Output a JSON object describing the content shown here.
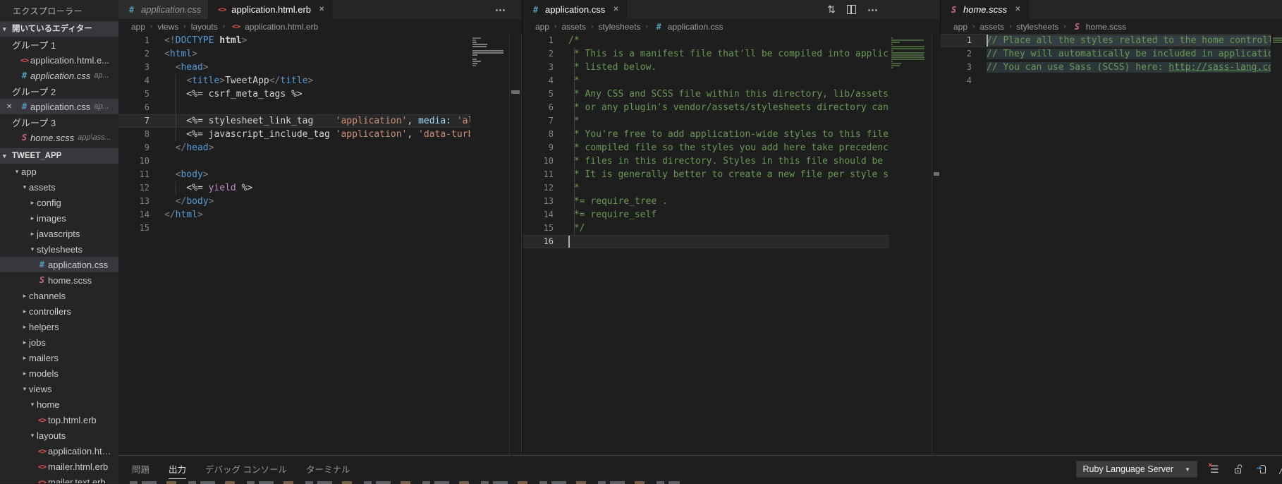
{
  "sidebar": {
    "title": "エクスプローラー",
    "open_editors_header": "開いているエディター",
    "open_editor_groups": [
      {
        "label": "グループ 1",
        "items": [
          {
            "icon": "erb-file-icon",
            "name": "application.html.e...",
            "desc": "",
            "italic": false,
            "selected": false,
            "close": false
          },
          {
            "icon": "css-file-icon",
            "name": "application.css",
            "desc": "ap...",
            "italic": true,
            "selected": false,
            "close": false
          }
        ]
      },
      {
        "label": "グループ 2",
        "items": [
          {
            "icon": "css-file-icon",
            "name": "application.css",
            "desc": "ap...",
            "italic": false,
            "selected": true,
            "close": true
          }
        ]
      },
      {
        "label": "グループ 3",
        "items": [
          {
            "icon": "scss-file-icon",
            "name": "home.scss",
            "desc": "app\\ass...",
            "italic": true,
            "selected": false,
            "close": false
          }
        ]
      }
    ],
    "project_name": "TWEET_APP",
    "tree": [
      {
        "depth": 0,
        "arrow": "expanded",
        "label": "app"
      },
      {
        "depth": 1,
        "arrow": "expanded",
        "label": "assets"
      },
      {
        "depth": 2,
        "arrow": "collapsed",
        "label": "config"
      },
      {
        "depth": 2,
        "arrow": "collapsed",
        "label": "images"
      },
      {
        "depth": 2,
        "arrow": "collapsed",
        "label": "javascripts"
      },
      {
        "depth": 2,
        "arrow": "expanded",
        "label": "stylesheets"
      },
      {
        "depth": 3,
        "icon": "css-file-icon",
        "label": "application.css",
        "selected": true
      },
      {
        "depth": 3,
        "icon": "scss-file-icon",
        "label": "home.scss"
      },
      {
        "depth": 1,
        "arrow": "collapsed",
        "label": "channels"
      },
      {
        "depth": 1,
        "arrow": "collapsed",
        "label": "controllers"
      },
      {
        "depth": 1,
        "arrow": "collapsed",
        "label": "helpers"
      },
      {
        "depth": 1,
        "arrow": "collapsed",
        "label": "jobs"
      },
      {
        "depth": 1,
        "arrow": "collapsed",
        "label": "mailers"
      },
      {
        "depth": 1,
        "arrow": "collapsed",
        "label": "models"
      },
      {
        "depth": 1,
        "arrow": "expanded",
        "label": "views"
      },
      {
        "depth": 2,
        "arrow": "expanded",
        "label": "home"
      },
      {
        "depth": 3,
        "icon": "erb-file-icon",
        "label": "top.html.erb"
      },
      {
        "depth": 2,
        "arrow": "expanded",
        "label": "layouts"
      },
      {
        "depth": 3,
        "icon": "erb-file-icon",
        "label": "application.html.e..."
      },
      {
        "depth": 3,
        "icon": "erb-file-icon",
        "label": "mailer.html.erb"
      },
      {
        "depth": 3,
        "icon": "erb-file-icon",
        "label": "mailer.text.erb"
      }
    ]
  },
  "editor_groups": [
    {
      "tabs": [
        {
          "icon": "erb-file-icon",
          "label": "application.html.erb",
          "active": true,
          "italic": false,
          "close": true
        },
        {
          "icon": "css-file-icon",
          "label": "application.css",
          "active": false,
          "italic": true,
          "close": false
        }
      ],
      "actions": [
        "more-actions"
      ],
      "breadcrumb": [
        {
          "label": "app"
        },
        {
          "label": "views"
        },
        {
          "label": "layouts"
        },
        {
          "label": "application.html.erb",
          "icon": "erb-file-icon"
        }
      ],
      "current_line": 7,
      "lines": [
        {
          "n": 1,
          "seg": [
            [
              "pun",
              "<!"
            ],
            [
              "tag",
              "DOCTYPE"
            ],
            [
              "txt",
              " "
            ],
            [
              "bold",
              "html"
            ],
            [
              "pun",
              ">"
            ]
          ]
        },
        {
          "n": 2,
          "seg": [
            [
              "pun",
              "<"
            ],
            [
              "tag",
              "html"
            ],
            [
              "pun",
              ">"
            ]
          ]
        },
        {
          "n": 3,
          "seg": [
            [
              "txt",
              "  "
            ],
            [
              "pun",
              "<"
            ],
            [
              "tag",
              "head"
            ],
            [
              "pun",
              ">"
            ]
          ]
        },
        {
          "n": 4,
          "seg": [
            [
              "txt",
              "    "
            ],
            [
              "pun",
              "<"
            ],
            [
              "tag",
              "title"
            ],
            [
              "pun",
              ">"
            ],
            [
              "txt",
              "TweetApp"
            ],
            [
              "pun",
              "</"
            ],
            [
              "tag",
              "title"
            ],
            [
              "pun",
              ">"
            ]
          ],
          "g": [
            2
          ]
        },
        {
          "n": 5,
          "seg": [
            [
              "txt",
              "    <%= csrf_meta_tags %>"
            ]
          ],
          "g": [
            2
          ]
        },
        {
          "n": 6,
          "seg": [],
          "g": [
            2
          ]
        },
        {
          "n": 7,
          "seg": [
            [
              "txt",
              "    <%= stylesheet_link_tag    "
            ],
            [
              "str",
              "'application'"
            ],
            [
              "txt",
              ", "
            ],
            [
              "attr",
              "media:"
            ],
            [
              "txt",
              " "
            ],
            [
              "str",
              "'al"
            ]
          ],
          "g": [
            2
          ]
        },
        {
          "n": 8,
          "seg": [
            [
              "txt",
              "    <%= javascript_include_tag "
            ],
            [
              "str",
              "'application'"
            ],
            [
              "txt",
              ", "
            ],
            [
              "str",
              "'data-turb"
            ]
          ],
          "g": [
            2
          ]
        },
        {
          "n": 9,
          "seg": [
            [
              "txt",
              "  "
            ],
            [
              "pun",
              "</"
            ],
            [
              "tag",
              "head"
            ],
            [
              "pun",
              ">"
            ]
          ]
        },
        {
          "n": 10,
          "seg": []
        },
        {
          "n": 11,
          "seg": [
            [
              "txt",
              "  "
            ],
            [
              "pun",
              "<"
            ],
            [
              "tag",
              "body"
            ],
            [
              "pun",
              ">"
            ]
          ]
        },
        {
          "n": 12,
          "seg": [
            [
              "txt",
              "    <%= "
            ],
            [
              "kw",
              "yield"
            ],
            [
              "txt",
              " %>"
            ]
          ],
          "g": [
            2
          ]
        },
        {
          "n": 13,
          "seg": [
            [
              "txt",
              "  "
            ],
            [
              "pun",
              "</"
            ],
            [
              "tag",
              "body"
            ],
            [
              "pun",
              ">"
            ]
          ]
        },
        {
          "n": 14,
          "seg": [
            [
              "pun",
              "</"
            ],
            [
              "tag",
              "html"
            ],
            [
              "pun",
              ">"
            ]
          ]
        },
        {
          "n": 15,
          "seg": []
        }
      ]
    },
    {
      "tabs": [
        {
          "icon": "css-file-icon",
          "label": "application.css",
          "active": true,
          "italic": false,
          "close": true
        }
      ],
      "actions": [
        "open-changes",
        "split-editor",
        "more-actions"
      ],
      "breadcrumb": [
        {
          "label": "app"
        },
        {
          "label": "assets"
        },
        {
          "label": "stylesheets"
        },
        {
          "label": "application.css",
          "icon": "css-file-icon"
        }
      ],
      "current_line": 16,
      "cursor_line": 16,
      "lines": [
        {
          "n": 1,
          "seg": [
            [
              "com",
              "/*"
            ]
          ]
        },
        {
          "n": 2,
          "seg": [
            [
              "com",
              " * This is a manifest file that'll be compiled into applica"
            ]
          ],
          "g": [
            1
          ]
        },
        {
          "n": 3,
          "seg": [
            [
              "com",
              " * listed below."
            ]
          ],
          "g": [
            1
          ]
        },
        {
          "n": 4,
          "seg": [
            [
              "com",
              " *"
            ]
          ],
          "g": [
            1
          ]
        },
        {
          "n": 5,
          "seg": [
            [
              "com",
              " * Any CSS and SCSS file within this directory, lib/assets/s"
            ]
          ],
          "g": [
            1
          ]
        },
        {
          "n": 6,
          "seg": [
            [
              "com",
              " * or any plugin's vendor/assets/stylesheets directory can b"
            ]
          ],
          "g": [
            1
          ]
        },
        {
          "n": 7,
          "seg": [
            [
              "com",
              " *"
            ]
          ],
          "g": [
            1
          ]
        },
        {
          "n": 8,
          "seg": [
            [
              "com",
              " * You're free to add application-wide styles to this file a"
            ]
          ],
          "g": [
            1
          ]
        },
        {
          "n": 9,
          "seg": [
            [
              "com",
              " * compiled file so the styles you add here take precedence"
            ]
          ],
          "g": [
            1
          ]
        },
        {
          "n": 10,
          "seg": [
            [
              "com",
              " * files in this directory. Styles in this file should be ad"
            ]
          ],
          "g": [
            1
          ]
        },
        {
          "n": 11,
          "seg": [
            [
              "com",
              " * It is generally better to create a new file per style sco"
            ]
          ],
          "g": [
            1
          ]
        },
        {
          "n": 12,
          "seg": [
            [
              "com",
              " *"
            ]
          ],
          "g": [
            1
          ]
        },
        {
          "n": 13,
          "seg": [
            [
              "com",
              " *= require_tree ."
            ]
          ],
          "g": [
            1
          ]
        },
        {
          "n": 14,
          "seg": [
            [
              "com",
              " *= require_self"
            ]
          ],
          "g": [
            1
          ]
        },
        {
          "n": 15,
          "seg": [
            [
              "com",
              " */"
            ]
          ],
          "g": [
            1
          ]
        },
        {
          "n": 16,
          "seg": []
        }
      ]
    },
    {
      "tabs": [
        {
          "icon": "scss-file-icon",
          "label": "home.scss",
          "active": true,
          "italic": true,
          "close": true
        }
      ],
      "actions": [],
      "breadcrumb": [
        {
          "label": "app"
        },
        {
          "label": "assets"
        },
        {
          "label": "stylesheets"
        },
        {
          "label": "home.scss",
          "icon": "scss-file-icon"
        }
      ],
      "current_line": 1,
      "cursor_line": 1,
      "selected_lines": [
        1,
        2,
        3
      ],
      "lines": [
        {
          "n": 1,
          "seg": [
            [
              "com",
              "// Place all the styles related to the home controlle"
            ]
          ]
        },
        {
          "n": 2,
          "seg": [
            [
              "com",
              "// They will automatically be included in applicatio"
            ]
          ]
        },
        {
          "n": 3,
          "seg": [
            [
              "com",
              "// You can use Sass (SCSS) here: "
            ],
            [
              "link",
              "http://sass-lang.co"
            ]
          ]
        },
        {
          "n": 4,
          "seg": []
        }
      ]
    }
  ],
  "panel": {
    "tabs": [
      {
        "label": "問題",
        "active": false
      },
      {
        "label": "出力",
        "active": true
      },
      {
        "label": "デバッグ コンソール",
        "active": false
      },
      {
        "label": "ターミナル",
        "active": false
      }
    ],
    "channel_select": "Ruby Language Server",
    "actions": [
      "clear-output",
      "toggle-auto-scroll-lock",
      "open-output-in-editor",
      "maximize-panel"
    ]
  },
  "colors": {
    "sidebar_bg": "#252526",
    "editor_bg": "#1e1e1e",
    "selection_bg": "#37373d",
    "css_icon": "#519aba",
    "scss_icon": "#cd6799",
    "erb_icon": "#d9544f",
    "comment": "#6a9955",
    "string": "#ce9178",
    "tag": "#569cd6",
    "keyword": "#c586c0"
  }
}
